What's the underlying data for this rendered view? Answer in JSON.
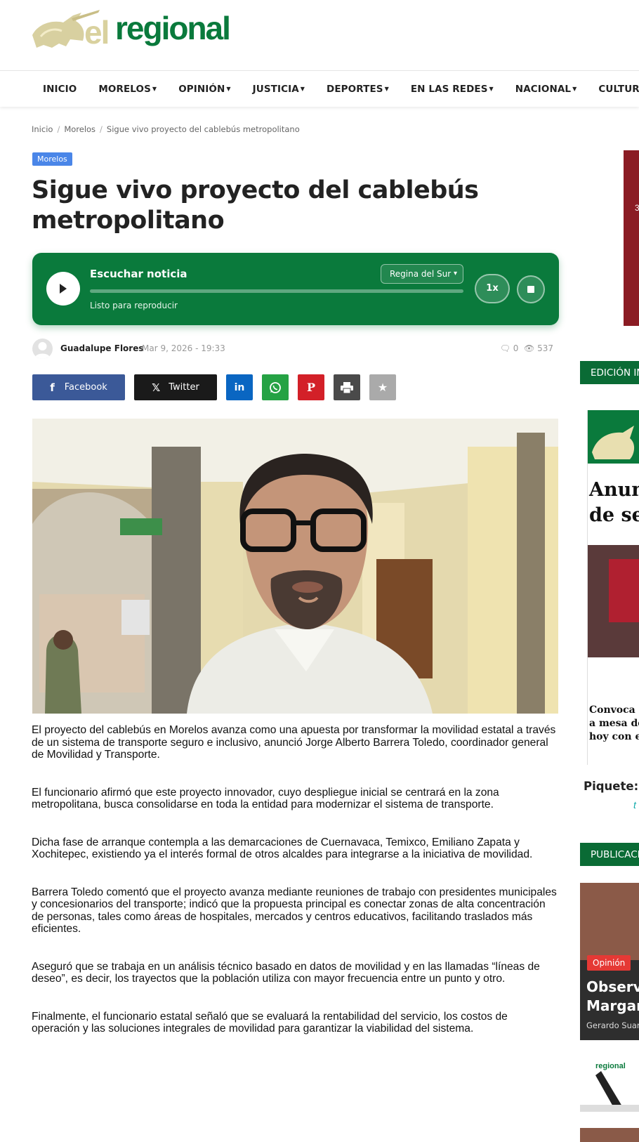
{
  "site": {
    "name": "elregional"
  },
  "nav": {
    "items": [
      {
        "label": "INICIO",
        "dropdown": false
      },
      {
        "label": "MORELOS",
        "dropdown": true
      },
      {
        "label": "OPINIÓN",
        "dropdown": true
      },
      {
        "label": "JUSTICIA",
        "dropdown": true
      },
      {
        "label": "DEPORTES",
        "dropdown": true
      },
      {
        "label": "EN LAS REDES",
        "dropdown": true
      },
      {
        "label": "NACIONAL",
        "dropdown": true
      },
      {
        "label": "CULTURA",
        "dropdown": true
      }
    ]
  },
  "breadcrumb": {
    "home": "Inicio",
    "section": "Morelos",
    "current": "Sigue vivo proyecto del cablebús metropolitano",
    "separator": "/"
  },
  "article": {
    "category": "Morelos",
    "title": "Sigue vivo proyecto del cablebús metropolitano",
    "author": "Guadalupe Flores",
    "date": "Mar 9, 2026 - 19:33",
    "comments": "0",
    "views": "537",
    "paragraphs": [
      "El proyecto del cablebús en Morelos avanza como una apuesta por transformar la movilidad estatal a través de un sistema de transporte seguro e inclusivo, anunció Jorge Alberto Barrera Toledo, coordinador general de Movilidad y Transporte.",
      "El funcionario afirmó que este proyecto innovador, cuyo despliegue inicial se centrará en la zona metropolitana, busca consolidarse en toda la entidad para modernizar el sistema de transporte.",
      "Dicha fase de arranque contempla a las demarcaciones de Cuernavaca, Temixco, Emiliano Zapata y Xochitepec, existiendo ya el interés formal de otros alcaldes para integrarse a la iniciativa de movilidad.",
      "Barrera Toledo comentó que el proyecto avanza mediante reuniones de trabajo con presidentes municipales y concesionarios del transporte; indicó que la propuesta principal es conectar zonas de alta concentración de personas, tales como áreas de hospitales, mercados y centros educativos, facilitando traslados más eficientes.",
      "Aseguró que se trabaja en un análisis técnico basado en datos de movilidad y en las llamadas “líneas de deseo”, es decir, los trayectos que la población utiliza con mayor frecuencia entre un punto y otro.",
      "Finalmente, el funcionario estatal señaló que se evaluará la rentabilidad del servicio, los costos de operación y las soluciones integrales de movilidad para garantizar la viabilidad del sistema."
    ]
  },
  "player": {
    "title": "Escuchar noticia",
    "status": "Listo para reproducir",
    "voice": "Regina del Sur",
    "speed": "1x",
    "progress": 0
  },
  "share": {
    "facebook": "Facebook",
    "twitter": "Twitter"
  },
  "sidebar": {
    "edition_heading": "EDICIÓN IM",
    "piquete_label": "Piquete:",
    "publications_heading": "PUBLICACI",
    "pub_badge": "Opinión",
    "pub_title_1": "Observa",
    "pub_title_2": "Margari",
    "pub_author": "Gerardo Suare",
    "paper_headline_1": "Anunci",
    "paper_headline_2": "de segu",
    "paper_sub_1": "Convoca la",
    "paper_sub_2": "a mesa de d",
    "paper_sub_3": "hoy con estu"
  },
  "colors": {
    "brand_green": "#0a7a3c",
    "category_blue": "#4a86e8",
    "facebook": "#3b5998",
    "twitter": "#1a1a1a",
    "linkedin": "#0a66c2",
    "whatsapp": "#25a244",
    "pinterest": "#d32028",
    "print": "#4a4a4a",
    "favorite": "#aaaaaa",
    "opinion_badge": "#e53935"
  }
}
